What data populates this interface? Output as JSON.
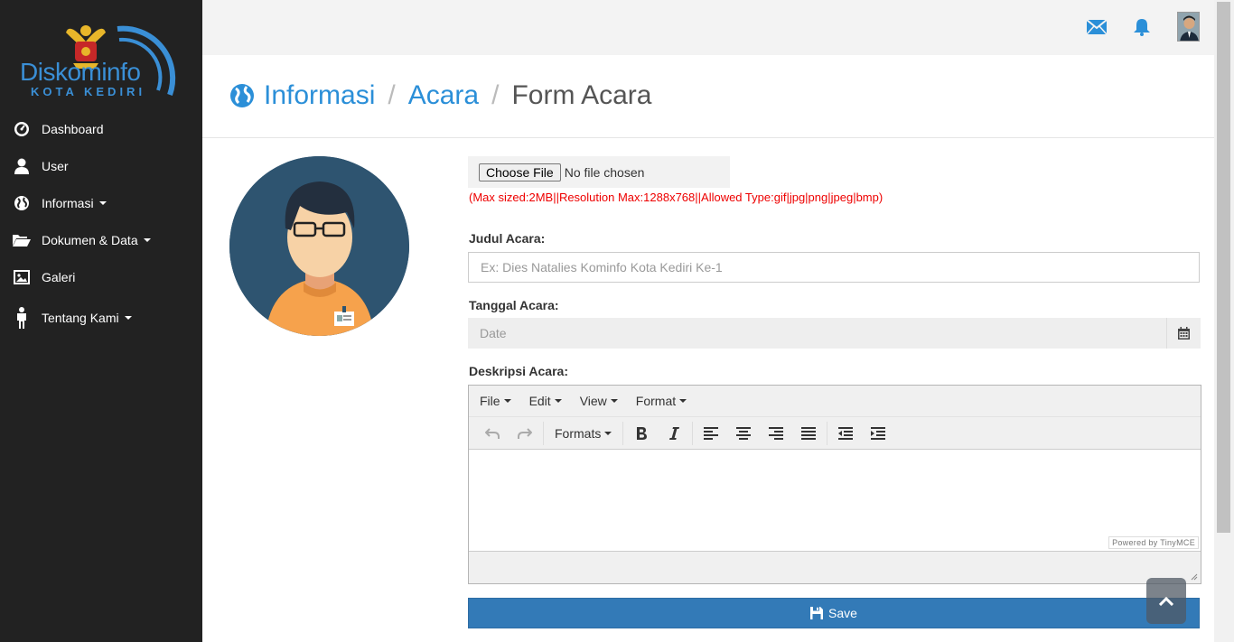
{
  "brand": {
    "name": "Diskominfo",
    "subtitle": "KOTA KEDIRI"
  },
  "sidebar": {
    "items": [
      {
        "label": "Dashboard",
        "icon": "dashboard-icon"
      },
      {
        "label": "User",
        "icon": "user-icon"
      },
      {
        "label": "Informasi",
        "icon": "globe-icon",
        "dropdown": true
      },
      {
        "label": "Dokumen & Data",
        "icon": "folder-open-icon",
        "dropdown": true
      },
      {
        "label": "Galeri",
        "icon": "picture-icon"
      },
      {
        "label": "Tentang Kami",
        "icon": "person-icon",
        "dropdown": true
      }
    ]
  },
  "topbar": {
    "icons": [
      "envelope-icon",
      "bell-icon",
      "user-avatar"
    ]
  },
  "breadcrumb": {
    "items": [
      "Informasi",
      "Acara"
    ],
    "current": "Form Acara",
    "separator": "/"
  },
  "form": {
    "file_button": "Choose File",
    "file_status": "No file chosen",
    "file_note": "(Max sized:2MB||Resolution Max:1288x768||Allowed Type:gif|jpg|png|jpeg|bmp)",
    "judul_label": "Judul Acara:",
    "judul_placeholder": "Ex: Dies Natalies Kominfo Kota Kediri Ke-1",
    "tanggal_label": "Tanggal Acara:",
    "tanggal_placeholder": "Date",
    "deskripsi_label": "Deskripsi Acara:",
    "save_label": "Save"
  },
  "editor": {
    "menus": [
      "File",
      "Edit",
      "View",
      "Format"
    ],
    "formats_label": "Formats",
    "powered_by": "Powered by TinyMCE"
  },
  "colors": {
    "sidebar": "#222222",
    "accent": "#2b8fd8",
    "save": "#337ab7",
    "error": "#ee0000"
  }
}
